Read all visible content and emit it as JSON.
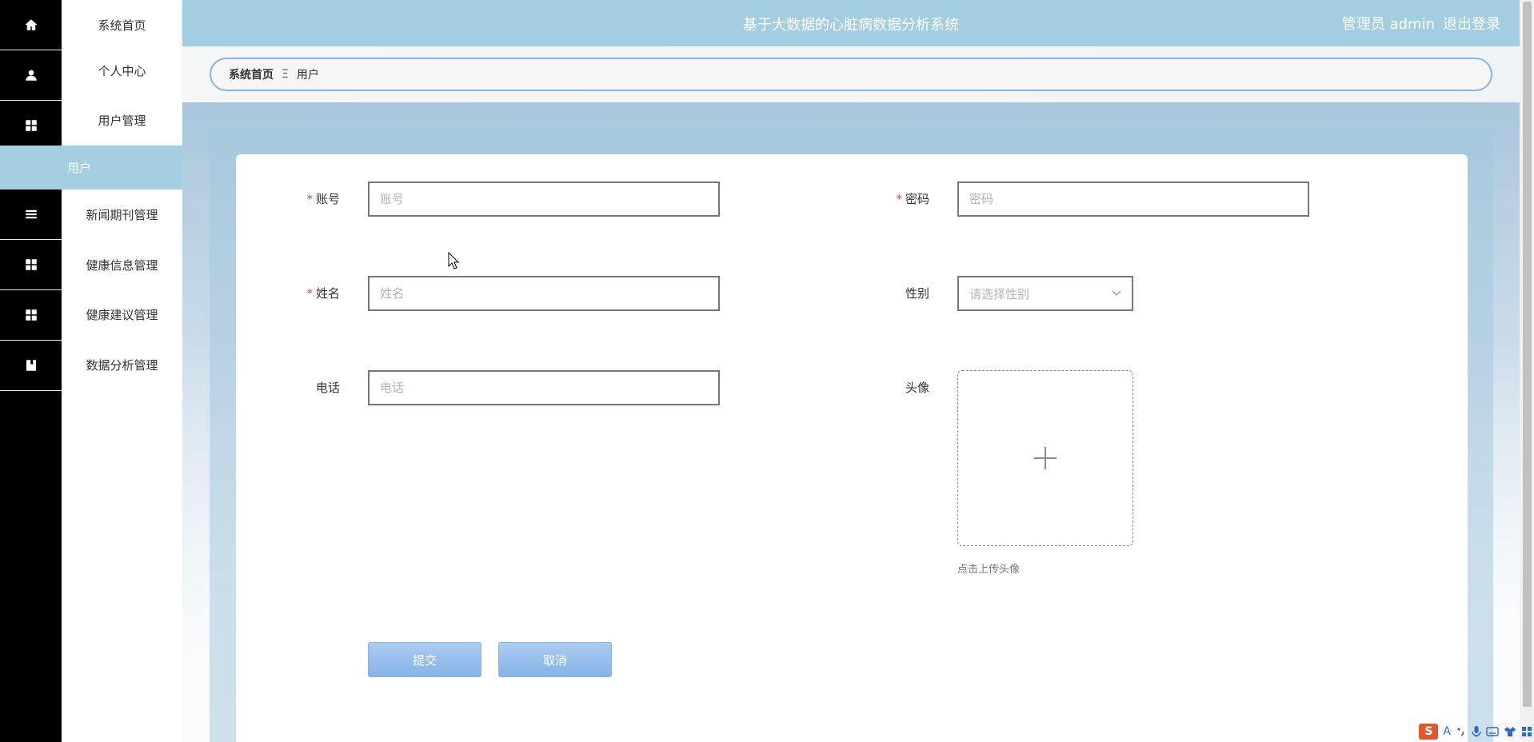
{
  "header": {
    "title": "基于大数据的心脏病数据分析系统",
    "user_label": "管理员 admin",
    "logout_label": "退出登录"
  },
  "sidebar": {
    "items": [
      {
        "label": "系统首页",
        "icon": "home-icon"
      },
      {
        "label": "个人中心",
        "icon": "person-icon"
      },
      {
        "label": "用户管理",
        "icon": "grid-icon"
      },
      {
        "label": "新闻期刊管理",
        "icon": "list-icon"
      },
      {
        "label": "健康信息管理",
        "icon": "grid-icon"
      },
      {
        "label": "健康建议管理",
        "icon": "grid-icon"
      },
      {
        "label": "数据分析管理",
        "icon": "book-icon"
      }
    ],
    "active_sub": "用户"
  },
  "breadcrumb": {
    "home": "系统首页",
    "separator": "Ξ",
    "current": "用户"
  },
  "form": {
    "account": {
      "label": "账号",
      "placeholder": "账号",
      "value": ""
    },
    "password": {
      "label": "密码",
      "placeholder": "密码",
      "value": ""
    },
    "name": {
      "label": "姓名",
      "placeholder": "姓名",
      "value": ""
    },
    "gender": {
      "label": "性别",
      "placeholder": "请选择性别"
    },
    "phone": {
      "label": "电话",
      "placeholder": "电话",
      "value": ""
    },
    "avatar": {
      "label": "头像",
      "hint": "点击上传头像"
    },
    "required_mark": "*"
  },
  "buttons": {
    "submit": "提交",
    "cancel": "取消"
  },
  "ime": {
    "logo": "S",
    "mode": "A"
  },
  "colors": {
    "header": "#a3cde0",
    "active_menu": "#a3cfe0",
    "button": "#86b2e6",
    "required": "#e04a4a"
  }
}
